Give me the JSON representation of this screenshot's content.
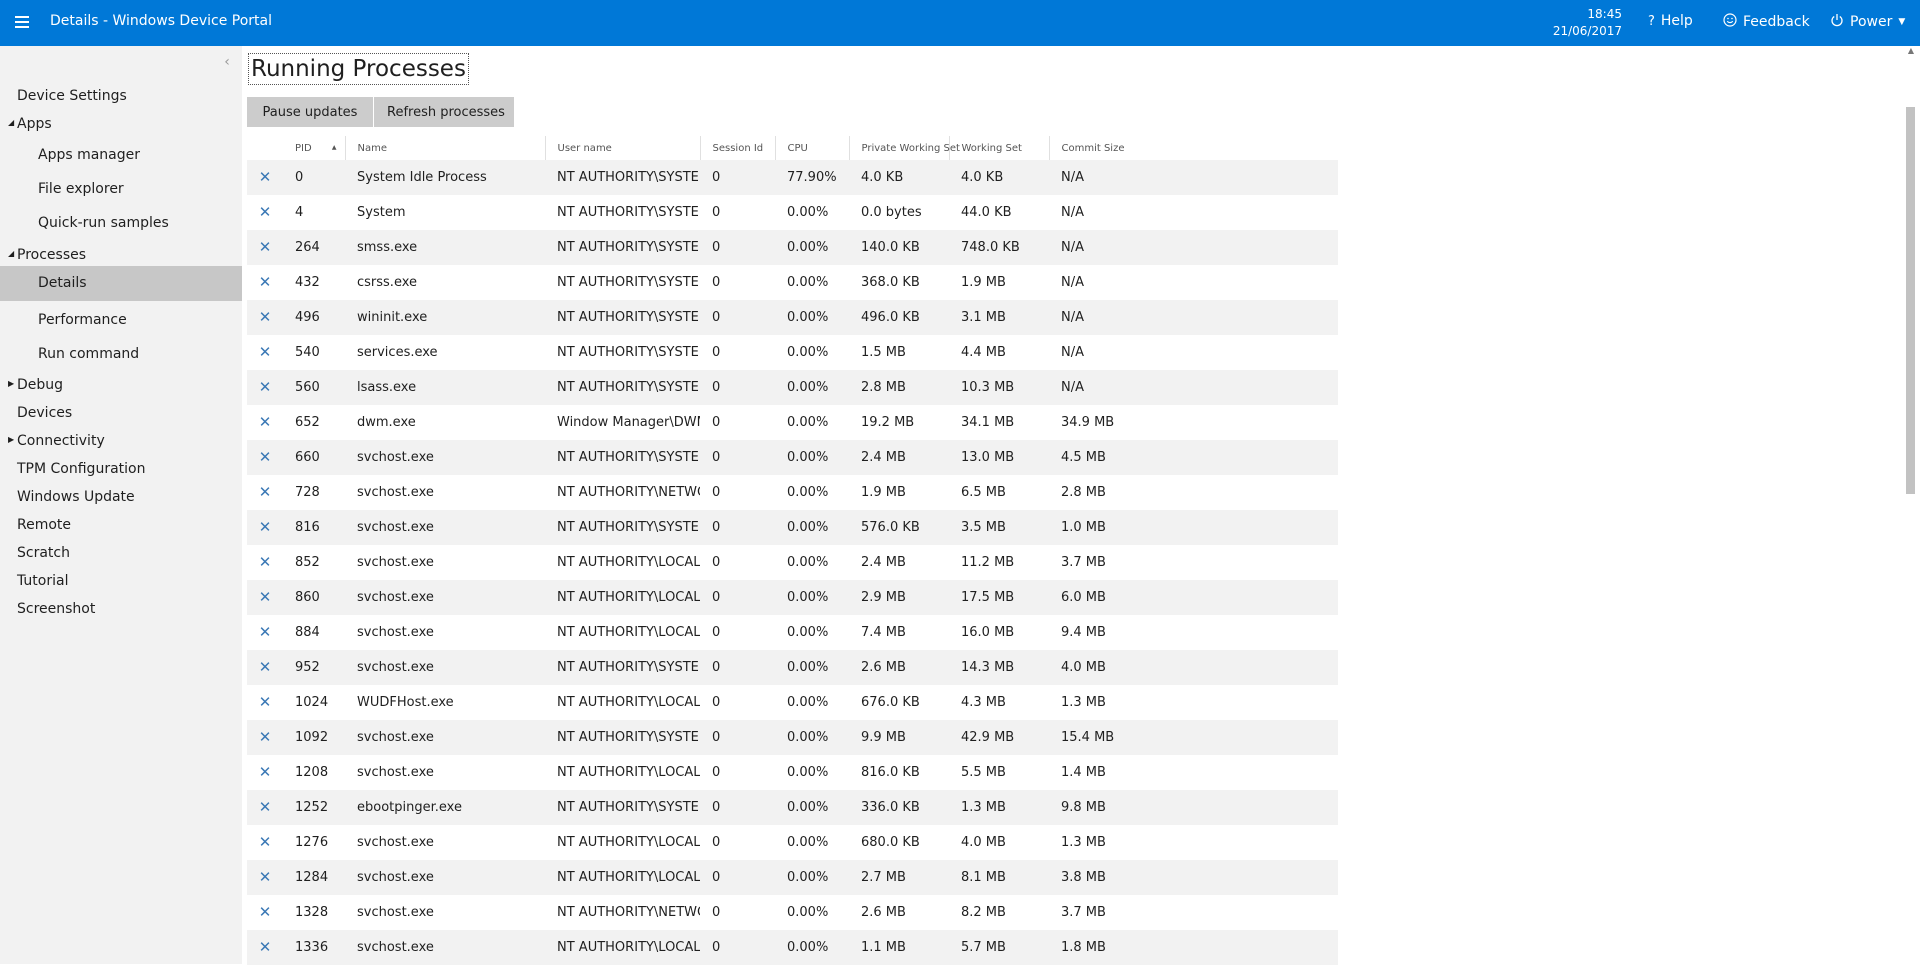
{
  "topbar": {
    "title": "Details - Windows Device Portal",
    "time": "18:45",
    "date": "21/06/2017",
    "help_label": "Help",
    "feedback_label": "Feedback",
    "power_label": "Power",
    "accent_color": "#0078d7"
  },
  "sidebar": {
    "items": [
      {
        "label": "Device Settings",
        "level": "top",
        "expander": ""
      },
      {
        "label": "Apps",
        "level": "top",
        "expander": "expanded"
      },
      {
        "label": "Apps manager",
        "level": "sub",
        "expander": ""
      },
      {
        "label": "File explorer",
        "level": "sub",
        "expander": ""
      },
      {
        "label": "Quick-run samples",
        "level": "sub",
        "expander": ""
      },
      {
        "label": "Processes",
        "level": "top",
        "expander": "expanded"
      },
      {
        "label": "Details",
        "level": "sub",
        "expander": "",
        "active": true
      },
      {
        "label": "Performance",
        "level": "sub",
        "expander": ""
      },
      {
        "label": "Run command",
        "level": "sub",
        "expander": ""
      },
      {
        "label": "Debug",
        "level": "top",
        "expander": "collapsed"
      },
      {
        "label": "Devices",
        "level": "top",
        "expander": ""
      },
      {
        "label": "Connectivity",
        "level": "top",
        "expander": "collapsed"
      },
      {
        "label": "TPM Configuration",
        "level": "top",
        "expander": ""
      },
      {
        "label": "Windows Update",
        "level": "top",
        "expander": ""
      },
      {
        "label": "Remote",
        "level": "top",
        "expander": ""
      },
      {
        "label": "Scratch",
        "level": "top",
        "expander": ""
      },
      {
        "label": "Tutorial",
        "level": "top",
        "expander": ""
      },
      {
        "label": "Screenshot",
        "level": "top",
        "expander": ""
      }
    ]
  },
  "main": {
    "title": "Running Processes",
    "pause_label": "Pause updates",
    "refresh_label": "Refresh processes",
    "sort_column": "PID",
    "columns": [
      "PID",
      "Name",
      "User name",
      "Session Id",
      "CPU",
      "Private Working Set",
      "Working Set",
      "Commit Size"
    ],
    "rows": [
      [
        "0",
        "System Idle Process",
        "NT AUTHORITY\\SYSTEM",
        "0",
        "77.90%",
        "4.0 KB",
        "4.0 KB",
        "N/A"
      ],
      [
        "4",
        "System",
        "NT AUTHORITY\\SYSTEM",
        "0",
        "0.00%",
        "0.0 bytes",
        "44.0 KB",
        "N/A"
      ],
      [
        "264",
        "smss.exe",
        "NT AUTHORITY\\SYSTEM",
        "0",
        "0.00%",
        "140.0 KB",
        "748.0 KB",
        "N/A"
      ],
      [
        "432",
        "csrss.exe",
        "NT AUTHORITY\\SYSTEM",
        "0",
        "0.00%",
        "368.0 KB",
        "1.9 MB",
        "N/A"
      ],
      [
        "496",
        "wininit.exe",
        "NT AUTHORITY\\SYSTEM",
        "0",
        "0.00%",
        "496.0 KB",
        "3.1 MB",
        "N/A"
      ],
      [
        "540",
        "services.exe",
        "NT AUTHORITY\\SYSTEM",
        "0",
        "0.00%",
        "1.5 MB",
        "4.4 MB",
        "N/A"
      ],
      [
        "560",
        "lsass.exe",
        "NT AUTHORITY\\SYSTEM",
        "0",
        "0.00%",
        "2.8 MB",
        "10.3 MB",
        "N/A"
      ],
      [
        "652",
        "dwm.exe",
        "Window Manager\\DWM...",
        "0",
        "0.00%",
        "19.2 MB",
        "34.1 MB",
        "34.9 MB"
      ],
      [
        "660",
        "svchost.exe",
        "NT AUTHORITY\\SYSTEM",
        "0",
        "0.00%",
        "2.4 MB",
        "13.0 MB",
        "4.5 MB"
      ],
      [
        "728",
        "svchost.exe",
        "NT AUTHORITY\\NETWO...",
        "0",
        "0.00%",
        "1.9 MB",
        "6.5 MB",
        "2.8 MB"
      ],
      [
        "816",
        "svchost.exe",
        "NT AUTHORITY\\SYSTEM",
        "0",
        "0.00%",
        "576.0 KB",
        "3.5 MB",
        "1.0 MB"
      ],
      [
        "852",
        "svchost.exe",
        "NT AUTHORITY\\LOCAL...",
        "0",
        "0.00%",
        "2.4 MB",
        "11.2 MB",
        "3.7 MB"
      ],
      [
        "860",
        "svchost.exe",
        "NT AUTHORITY\\LOCAL...",
        "0",
        "0.00%",
        "2.9 MB",
        "17.5 MB",
        "6.0 MB"
      ],
      [
        "884",
        "svchost.exe",
        "NT AUTHORITY\\LOCAL...",
        "0",
        "0.00%",
        "7.4 MB",
        "16.0 MB",
        "9.4 MB"
      ],
      [
        "952",
        "svchost.exe",
        "NT AUTHORITY\\SYSTEM",
        "0",
        "0.00%",
        "2.6 MB",
        "14.3 MB",
        "4.0 MB"
      ],
      [
        "1024",
        "WUDFHost.exe",
        "NT AUTHORITY\\LOCAL...",
        "0",
        "0.00%",
        "676.0 KB",
        "4.3 MB",
        "1.3 MB"
      ],
      [
        "1092",
        "svchost.exe",
        "NT AUTHORITY\\SYSTEM",
        "0",
        "0.00%",
        "9.9 MB",
        "42.9 MB",
        "15.4 MB"
      ],
      [
        "1208",
        "svchost.exe",
        "NT AUTHORITY\\LOCAL...",
        "0",
        "0.00%",
        "816.0 KB",
        "5.5 MB",
        "1.4 MB"
      ],
      [
        "1252",
        "ebootpinger.exe",
        "NT AUTHORITY\\SYSTEM",
        "0",
        "0.00%",
        "336.0 KB",
        "1.3 MB",
        "9.8 MB"
      ],
      [
        "1276",
        "svchost.exe",
        "NT AUTHORITY\\LOCAL...",
        "0",
        "0.00%",
        "680.0 KB",
        "4.0 MB",
        "1.3 MB"
      ],
      [
        "1284",
        "svchost.exe",
        "NT AUTHORITY\\LOCAL...",
        "0",
        "0.00%",
        "2.7 MB",
        "8.1 MB",
        "3.8 MB"
      ],
      [
        "1328",
        "svchost.exe",
        "NT AUTHORITY\\NETWO...",
        "0",
        "0.00%",
        "2.6 MB",
        "8.2 MB",
        "3.7 MB"
      ],
      [
        "1336",
        "svchost.exe",
        "NT AUTHORITY\\LOCAL...",
        "0",
        "0.00%",
        "1.1 MB",
        "5.7 MB",
        "1.8 MB"
      ]
    ]
  }
}
